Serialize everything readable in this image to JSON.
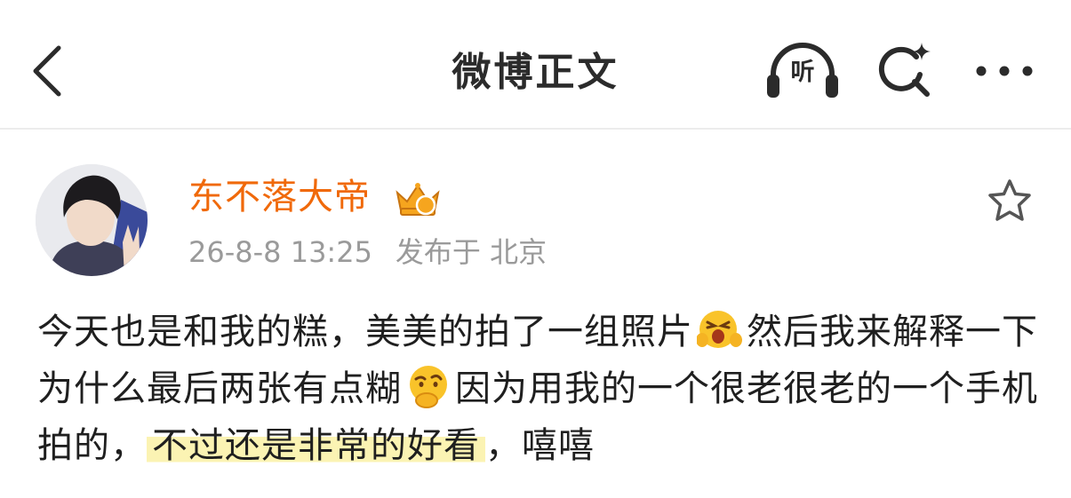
{
  "nav": {
    "title": "微博正文",
    "listen_label": "听",
    "back_icon": "back-arrow-icon",
    "search_icon": "search-icon",
    "more_icon": "more-dots-icon"
  },
  "post": {
    "author": "东不落大帝",
    "badge_icon": "crown-badge-icon",
    "timestamp": "26-8-8 13:25",
    "location": "发布于 北京",
    "favorite_icon": "star-outline-icon",
    "content": {
      "text1": "今天也是和我的糕，美美的拍了一组照片",
      "emoji1": "grinning-excited-emoji",
      "text2": "然后我来解释一下为什么最后两张有点糊",
      "emoji2": "thinking-emoji",
      "text3": "因为用我的一个很老很老的一个手机拍的，",
      "highlight": "不过还是非常的好看",
      "text4": "，嘻嘻"
    }
  },
  "colors": {
    "author": "#f0690a",
    "meta": "#9a9a9a",
    "highlight": "#fbf3b3"
  }
}
